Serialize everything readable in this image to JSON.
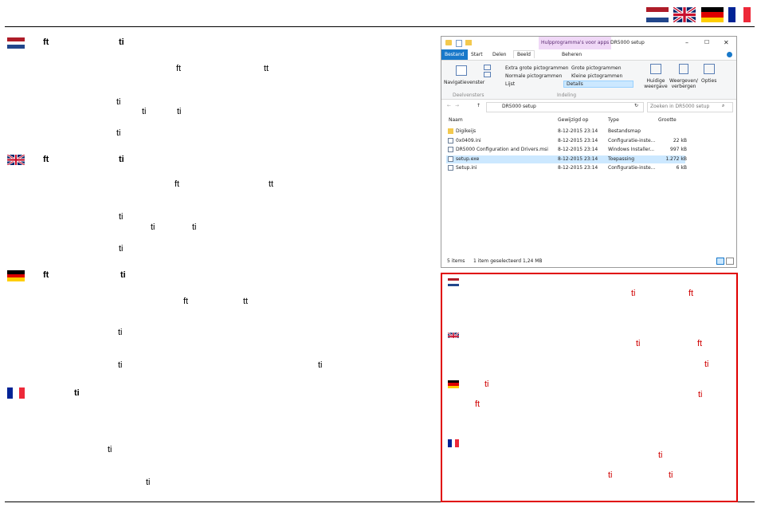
{
  "explorer": {
    "context_tab": "Hulpprogramma's voor apps",
    "window_title": "DR5000 setup",
    "min_glyph": "–",
    "max_glyph": "☐",
    "close_glyph": "✕",
    "ribbon_tabs": [
      "Bestand",
      "Start",
      "Delen",
      "Beeld",
      "Beheren"
    ],
    "pane_label": "Navigatievenster",
    "pane_group": "Deelvensters",
    "layout_options": [
      "Extra grote pictogrammen",
      "Grote pictogrammen",
      "Normale pictogrammen",
      "Kleine pictogrammen",
      "Lijst",
      "Details"
    ],
    "layout_group": "Indeling",
    "view_current": "Huidige weergave",
    "show_hide": "Weergeven/ verbergen",
    "options": "Opties",
    "path": "DR5000 setup",
    "search_placeholder": "Zoeken in DR5000 setup",
    "columns": [
      "Naam",
      "Gewijzigd op",
      "Type",
      "Grootte"
    ],
    "files": [
      {
        "name": "Digikeijs",
        "date": "8-12-2015 23:14",
        "type": "Bestandsmap",
        "size": "",
        "selected": false
      },
      {
        "name": "0x0409.ini",
        "date": "8-12-2015 23:14",
        "type": "Configuratie-inste...",
        "size": "22 kB",
        "selected": false
      },
      {
        "name": "DR5000 Configuration and Drivers.msi",
        "date": "8-12-2015 23:14",
        "type": "Windows Installer...",
        "size": "997 kB",
        "selected": false
      },
      {
        "name": "setup.exe",
        "date": "8-12-2015 23:14",
        "type": "Toepassing",
        "size": "1.272 kB",
        "selected": true
      },
      {
        "name": "Setup.ini",
        "date": "8-12-2015 23:14",
        "type": "Configuratie-inste...",
        "size": "6 kB",
        "selected": false
      }
    ],
    "status_items": "5 items",
    "status_selected": "1 item geselecteerd 1,24 MB"
  },
  "left_text": {
    "nl": [
      "ft",
      "ti",
      "ft",
      "tt",
      "ti",
      "ti",
      "ti",
      "ti"
    ],
    "en": [
      "ft",
      "ti",
      "ft",
      "tt",
      "ti",
      "ti",
      "ti",
      "ti"
    ],
    "de": [
      "ft",
      "ti",
      "ft",
      "tt",
      "ti",
      "ti",
      "ti"
    ],
    "fr": [
      "ti",
      "ti",
      "ti"
    ]
  },
  "box_text": {
    "nl": [
      "ti",
      "ft"
    ],
    "en": [
      "ti",
      "ft",
      "ti"
    ],
    "de": [
      "ti",
      "ti",
      "ft"
    ],
    "fr": [
      "ti",
      "ti",
      "ti"
    ]
  },
  "colors": {
    "highlight_red": "#e00000",
    "text_red": "#d00000",
    "selection_blue": "#cce8ff"
  }
}
